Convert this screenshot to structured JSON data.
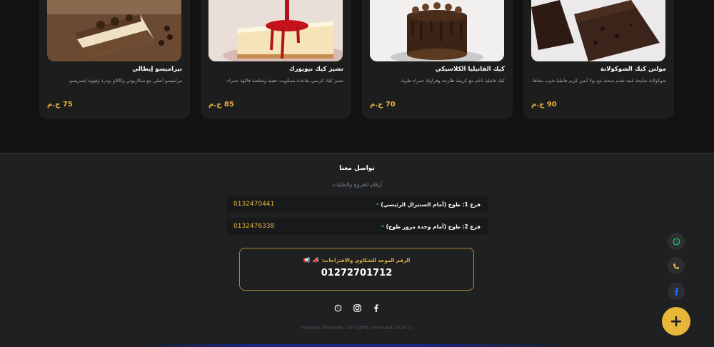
{
  "products": [
    {
      "name": "تيراميسو إيطالي",
      "desc": "تيراميسو أصلي مع سكاربوني وكاكاو بودرة وقهوة إسبريسو.",
      "price": "75 ج.م"
    },
    {
      "name": "تشيز كيك نيويورك",
      "desc": "تشيز كيك كريمي بقاعدة بسكويت ذهبية وصلصة فاكهة حمراء.",
      "price": "85 ج.م"
    },
    {
      "name": "كيك الفانيليا الكلاسيكي",
      "desc": "كيك فانيليا ناعم مع كريمة طازجة وفراولة حمراء طرية.",
      "price": "70 ج.م"
    },
    {
      "name": "مولتن كيك الشوكولاتة",
      "desc": "شوكولاتة سايحة غنية تقدم سخنة مع بولا آيس كريم فانيليا تذوب معاها.",
      "price": "90 ج.م"
    }
  ],
  "footer": {
    "title": "تواصل معنا",
    "subtitle": "أرقام للفروع والطلبات",
    "branches": [
      {
        "label": "فرع 1: طوخ (أمام السنترال الرئيسي)",
        "phone": "0132470441"
      },
      {
        "label": "فرع 2: طوخ (أمام وحدة مرور طوخ)",
        "phone": "0132476338"
      }
    ],
    "hotline": {
      "title": "الرقم الموحد للشكاوى والاقتراحات:",
      "number": "01272701712"
    },
    "copyright": "Fewyda Desserts. All rights reserved 2026 ©"
  },
  "fab_label": "+",
  "colors": {
    "accent": "#e7b73a",
    "price": "#e6b43c",
    "background": "#1e2022",
    "card": "#1d1d1d"
  }
}
